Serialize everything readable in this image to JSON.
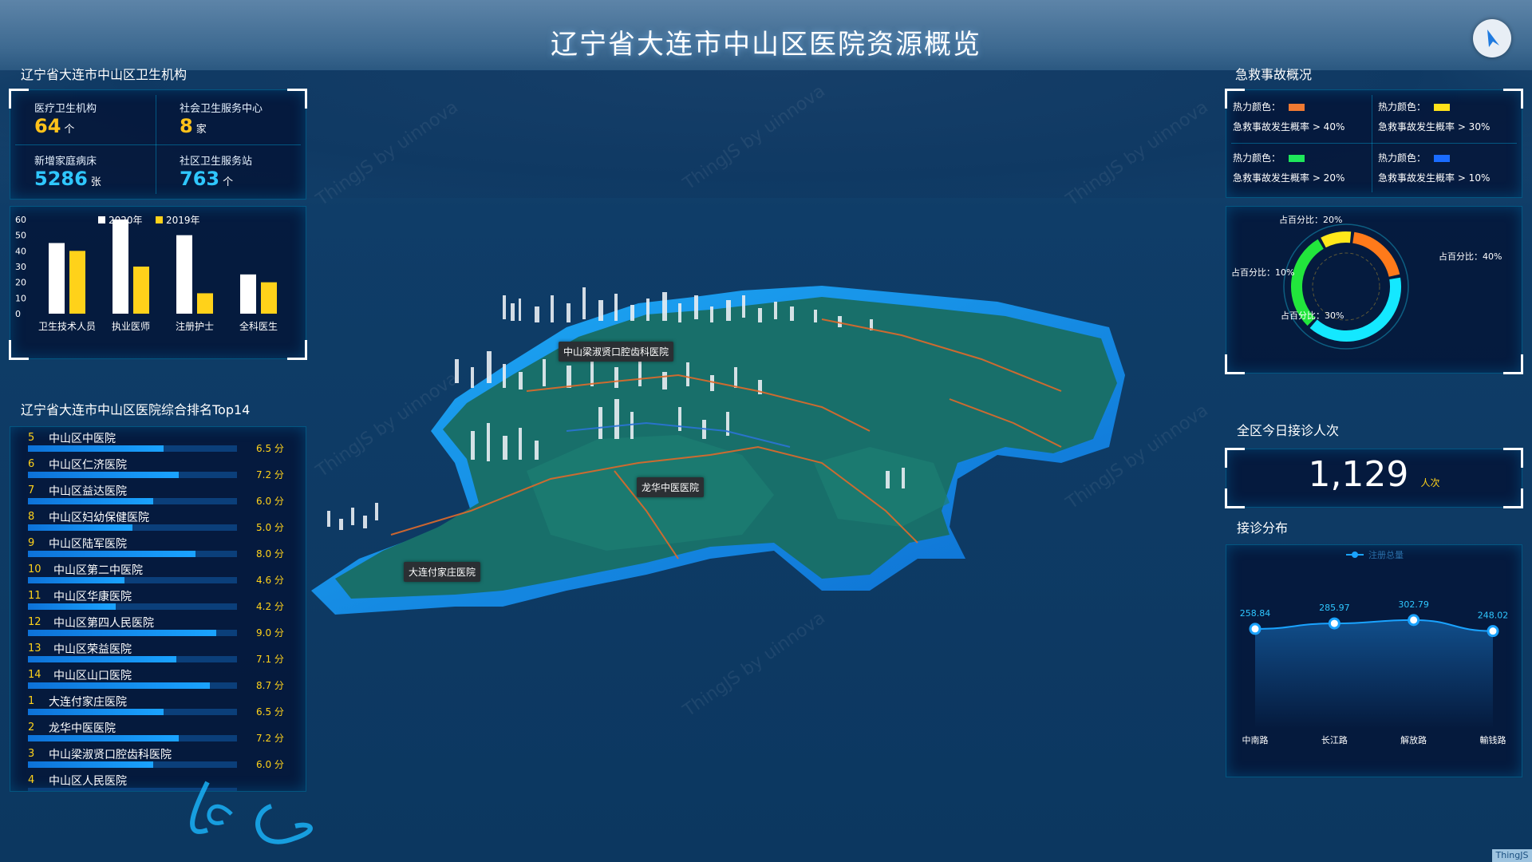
{
  "title": "辽宁省大连市中山区医院资源概览",
  "left": {
    "org_title": "辽宁省大连市中山区卫生机构",
    "stats": [
      {
        "label": "医疗卫生机构",
        "value": "64",
        "unit": "个",
        "color": "#ffc21a"
      },
      {
        "label": "社会卫生服务中心",
        "value": "8",
        "unit": "家",
        "color": "#ffc21a"
      },
      {
        "label": "新增家庭病床",
        "value": "5286",
        "unit": "张",
        "color": "#2fc7ff"
      },
      {
        "label": "社区卫生服务站",
        "value": "763",
        "unit": "个",
        "color": "#2fc7ff"
      }
    ],
    "rank_title": "辽宁省大连市中山区医院综合排名Top14",
    "rankings": [
      {
        "num": "5",
        "name": "中山区中医院",
        "score": "6.5 分",
        "fill": 0.65
      },
      {
        "num": "6",
        "name": "中山区仁济医院",
        "score": "7.2 分",
        "fill": 0.72
      },
      {
        "num": "7",
        "name": "中山区益达医院",
        "score": "6.0 分",
        "fill": 0.6
      },
      {
        "num": "8",
        "name": "中山区妇幼保健医院",
        "score": "5.0 分",
        "fill": 0.5
      },
      {
        "num": "9",
        "name": "中山区陆军医院",
        "score": "8.0 分",
        "fill": 0.8
      },
      {
        "num": "10",
        "name": "中山区第二中医院",
        "score": "4.6 分",
        "fill": 0.46
      },
      {
        "num": "11",
        "name": "中山区华康医院",
        "score": "4.2 分",
        "fill": 0.42
      },
      {
        "num": "12",
        "name": "中山区第四人民医院",
        "score": "9.0 分",
        "fill": 0.9
      },
      {
        "num": "13",
        "name": "中山区荣益医院",
        "score": "7.1 分",
        "fill": 0.71
      },
      {
        "num": "14",
        "name": "中山区山口医院",
        "score": "8.7 分",
        "fill": 0.87
      },
      {
        "num": "1",
        "name": "大连付家庄医院",
        "score": "6.5 分",
        "fill": 0.65
      },
      {
        "num": "2",
        "name": "龙华中医医院",
        "score": "7.2 分",
        "fill": 0.72
      },
      {
        "num": "3",
        "name": "中山梁淑贤口腔齿科医院",
        "score": "6.0 分",
        "fill": 0.6
      },
      {
        "num": "4",
        "name": "中山区人民医院",
        "score": "",
        "fill": 0.0
      }
    ]
  },
  "chart_data": [
    {
      "type": "bar",
      "categories": [
        "卫生技术人员",
        "执业医师",
        "注册护士",
        "全科医生"
      ],
      "series": [
        {
          "name": "2020年",
          "values": [
            45,
            60,
            50,
            25
          ],
          "color": "#ffffff"
        },
        {
          "name": "2019年",
          "values": [
            40,
            30,
            13,
            20
          ],
          "color": "#ffd21a"
        }
      ],
      "ylim": [
        0,
        60
      ],
      "yticks": [
        "0",
        "10",
        "20",
        "30",
        "40",
        "50",
        "60"
      ],
      "legend": "top"
    },
    {
      "type": "pie",
      "labels": [
        "占百分比：20%",
        "占百分比：40%",
        "占百分比：30%",
        "占百分比：10%"
      ],
      "values": [
        20,
        40,
        30,
        10
      ],
      "colors": [
        "#ff7a1a",
        "#14e8ff",
        "#22e63c",
        "#ffe81a"
      ]
    },
    {
      "type": "line",
      "categories": [
        "中南路",
        "长江路",
        "解放路",
        "輸钱路"
      ],
      "series": [
        {
          "name": "注册总量",
          "values": [
            258.84,
            285.97,
            302.79,
            248.02
          ]
        }
      ],
      "data_labels": [
        "258.84",
        "285.97",
        "302.79",
        "248.02"
      ]
    }
  ],
  "right": {
    "accident_title": "急救事故概况",
    "heat_legend": [
      {
        "label": "热力颜色：",
        "desc": "急救事故发生概率 > 40%",
        "color": "#f07a32"
      },
      {
        "label": "热力颜色：",
        "desc": "急救事故发生概率 > 30%",
        "color": "#ffe21a"
      },
      {
        "label": "热力颜色：",
        "desc": "急救事故发生概率 > 20%",
        "color": "#1ee85a"
      },
      {
        "label": "热力颜色：",
        "desc": "急救事故发生概率 > 10%",
        "color": "#1a6cff"
      }
    ],
    "visits_title": "全区今日接诊人次",
    "visits_value": "1,129",
    "visits_unit": "人次",
    "dist_title": "接诊分布"
  },
  "map": {
    "labels": [
      "中山梁淑贤口腔齿科医院",
      "龙华中医医院",
      "大连付家庄医院"
    ],
    "watermark": "ThingJS by uinnova",
    "badge": "ThingJS"
  },
  "colors": {
    "accent": "#1aa3ff",
    "gold": "#ffd21a",
    "cyan": "#2fc7ff"
  }
}
